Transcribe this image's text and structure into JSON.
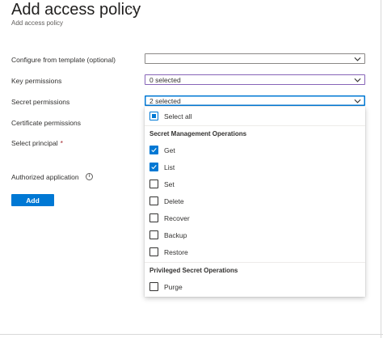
{
  "header": {
    "title": "Add access policy",
    "more_glyph": "···",
    "subtitle": "Add access policy"
  },
  "form": {
    "template_label": "Configure from template (optional)",
    "template_value": "",
    "key_permissions_label": "Key permissions",
    "key_permissions_value": "0 selected",
    "secret_permissions_label": "Secret permissions",
    "secret_permissions_value": "2 selected",
    "certificate_permissions_label": "Certificate permissions",
    "select_principal_label": "Select principal",
    "required_marker": "*",
    "authorized_application_label": "Authorized application",
    "info_glyph": "i",
    "add_button_label": "Add"
  },
  "secret_dropdown": {
    "select_all_label": "Select all",
    "select_all_state": "indeterminate",
    "groups": [
      {
        "header": "Secret Management Operations",
        "options": [
          {
            "label": "Get",
            "checked": true
          },
          {
            "label": "List",
            "checked": true
          },
          {
            "label": "Set",
            "checked": false
          },
          {
            "label": "Delete",
            "checked": false
          },
          {
            "label": "Recover",
            "checked": false
          },
          {
            "label": "Backup",
            "checked": false
          },
          {
            "label": "Restore",
            "checked": false
          }
        ]
      },
      {
        "header": "Privileged Secret Operations",
        "options": [
          {
            "label": "Purge",
            "checked": false
          }
        ]
      }
    ]
  },
  "colors": {
    "accent": "#0078d4",
    "hover_border": "#8764b8",
    "required": "#a4262c"
  },
  "icons": {
    "dropdown": "chevron-down-icon",
    "checkmark": "checkmark-icon",
    "info": "info-icon",
    "more": "more-icon"
  }
}
